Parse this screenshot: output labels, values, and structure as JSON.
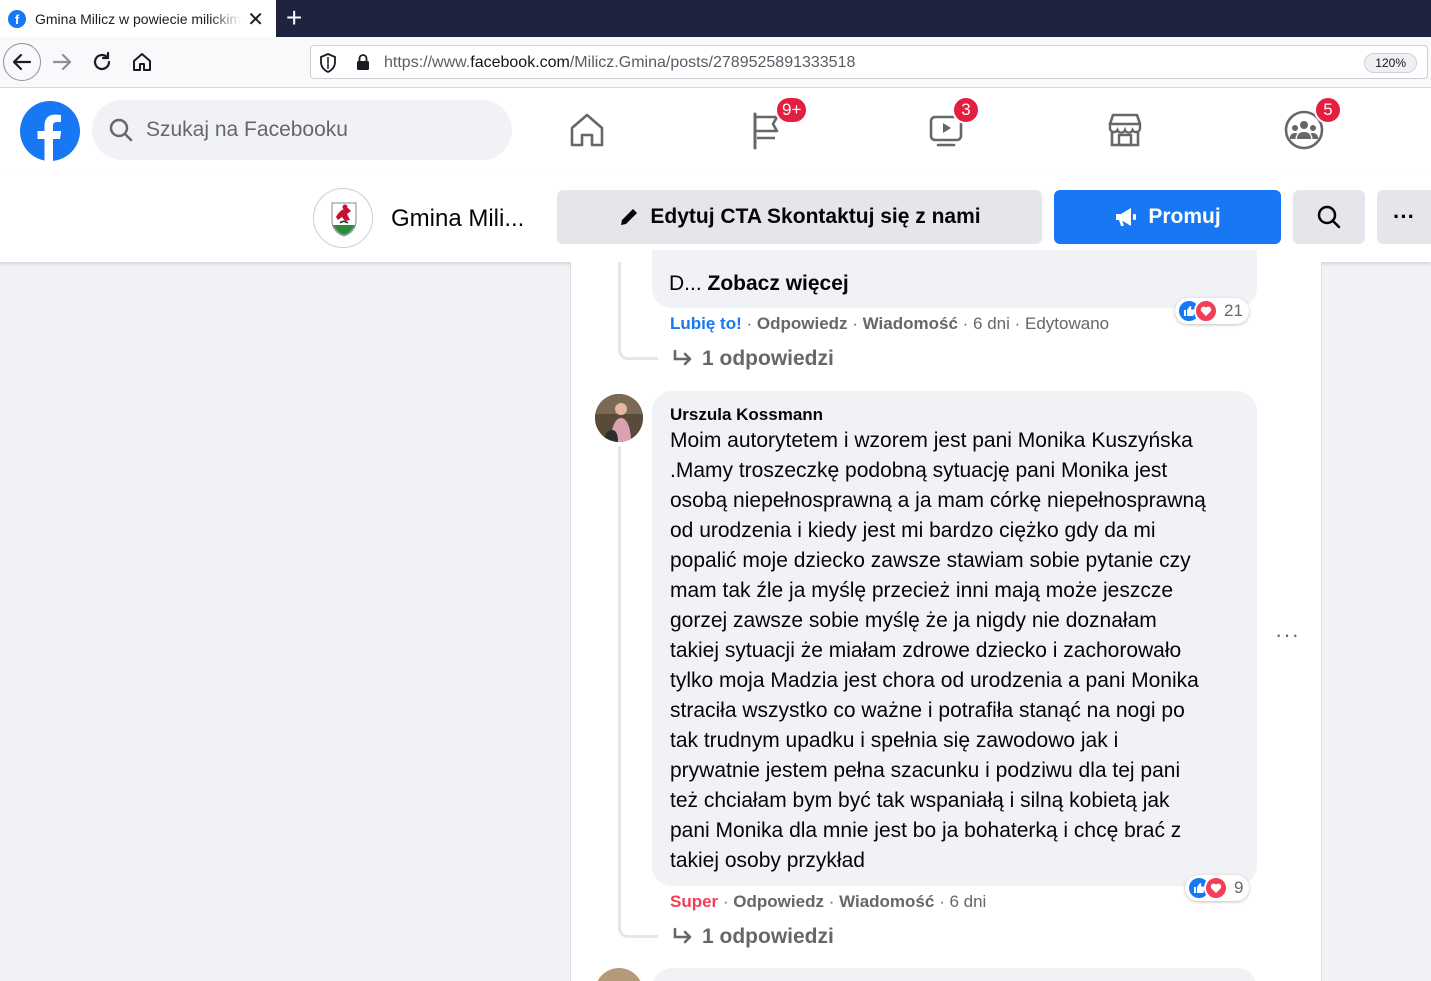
{
  "browser": {
    "tab_title": "Gmina Milicz w powiecie milickim",
    "tab_close": "✕",
    "new_tab": "+",
    "url_prefix": "https://www.",
    "url_domain": "facebook.com",
    "url_path": "/Milicz.Gmina/posts/2789525891333518",
    "zoom": "120%"
  },
  "facebook": {
    "logo_letter": "f",
    "search_placeholder": "Szukaj na Facebooku",
    "nav": [
      {
        "name": "home",
        "badge": ""
      },
      {
        "name": "pages",
        "badge": "9+"
      },
      {
        "name": "watch",
        "badge": "3"
      },
      {
        "name": "marketplace",
        "badge": ""
      },
      {
        "name": "groups",
        "badge": "5"
      }
    ]
  },
  "page_header": {
    "name": "Gmina Mili...",
    "edit_cta_label": "Edytuj CTA Skontaktuj się z nami",
    "promote_label": "Promuj",
    "more_label": "···"
  },
  "comments": [
    {
      "text_tail_prefix": "D... ",
      "see_more": "Zobacz więcej",
      "reaction_label": "Lubię to!",
      "reply_label": "Odpowiedz",
      "message_label": "Wiadomość",
      "time": "6 dni",
      "edited": "Edytowano",
      "reaction_count": "21",
      "replies": "1 odpowiedzi"
    },
    {
      "author": "Urszula Kossmann",
      "lines": [
        "Moim autorytetem i wzorem jest pani Monika Kuszyńska",
        ".Mamy troszeczkę podobną sytuację pani Monika jest",
        "osobą niepełnosprawną a ja mam córkę niepełnosprawną",
        "od urodzenia i kiedy jest mi bardzo ciężko gdy da mi",
        "popalić moje dziecko zawsze stawiam sobie pytanie czy",
        "mam tak źle ja myślę przecież inni mają może jeszcze",
        "gorzej zawsze sobie myślę że ja nigdy nie doznałam",
        "takiej sytuacji że miałam zdrowe dziecko i zachorowało",
        "tylko moja Madzia jest chora od urodzenia a pani Monika",
        "straciła wszystko co ważne i potrafiła stanąć na nogi po",
        "tak trudnym upadku i spełnia się zawodowo jak i",
        "prywatnie jestem pełna szacunku i podziwu dla tej pani",
        "też chciałam bym być tak wspaniałą i silną kobietą jak",
        "pani Monika dla mnie jest bo ja bohaterką i chcę brać z",
        "takiej osoby przykład"
      ],
      "reaction_label": "Super",
      "reply_label": "Odpowiedz",
      "message_label": "Wiadomość",
      "time": "6 dni",
      "reaction_count": "9",
      "replies": "1 odpowiedzi",
      "more_label": "···"
    }
  ],
  "separator": " · ",
  "colors": {
    "fb_blue": "#1877f2",
    "super_red": "#f33e58",
    "badge_red": "#e41e3f"
  }
}
